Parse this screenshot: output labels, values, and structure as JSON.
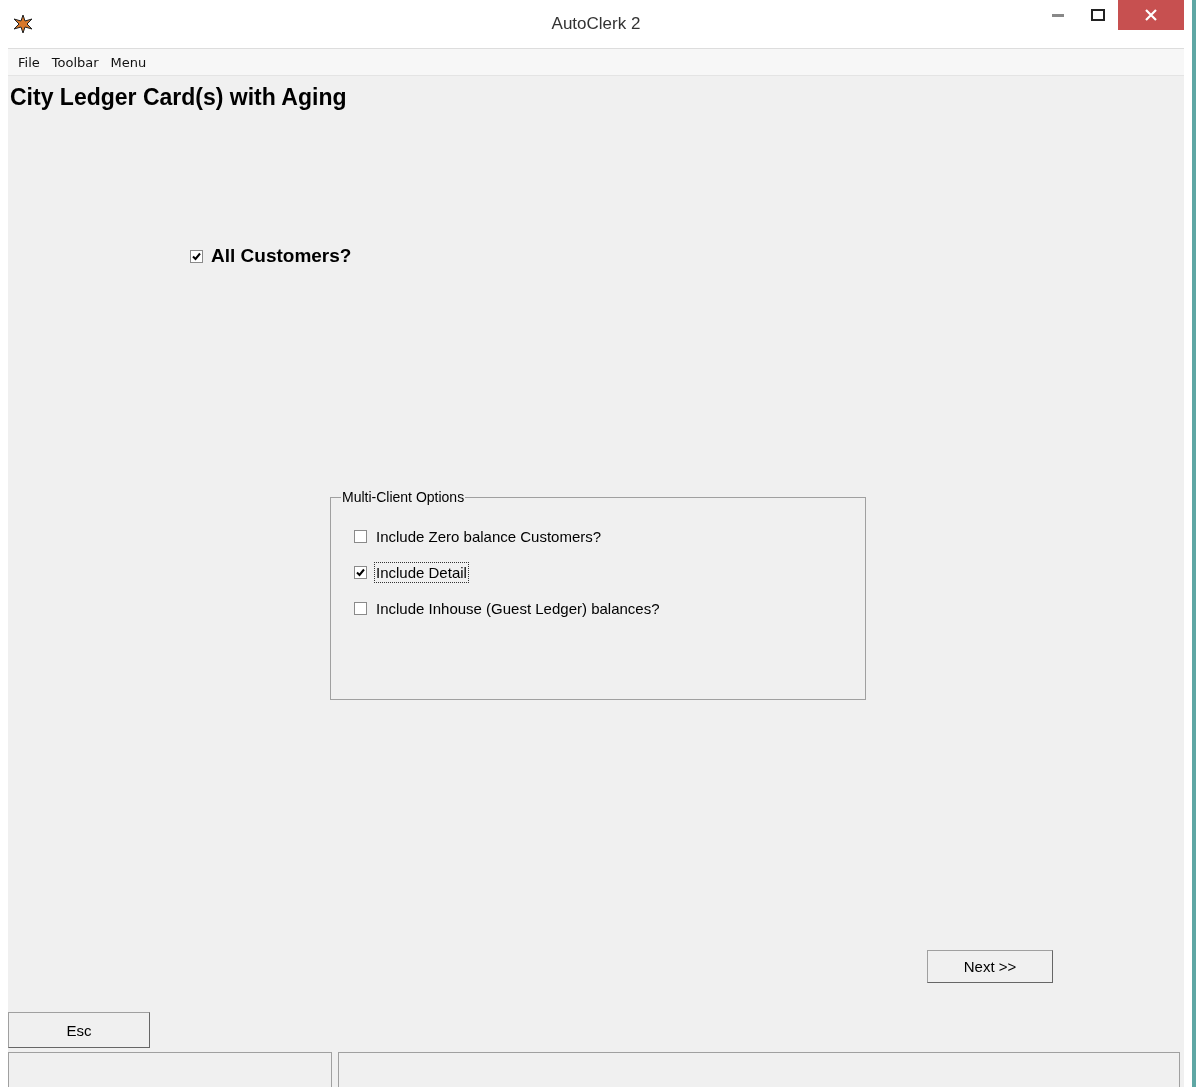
{
  "window": {
    "title": "AutoClerk 2"
  },
  "menu": [
    "File",
    "Toolbar",
    "Menu"
  ],
  "heading": "City Ledger Card(s) with Aging",
  "all_customers": {
    "label": "All Customers?",
    "checked": true
  },
  "group": {
    "title": "Multi-Client Options",
    "options": [
      {
        "label": "Include Zero balance Customers?",
        "checked": false,
        "focused": false
      },
      {
        "label": "Include Detail",
        "checked": true,
        "focused": true
      },
      {
        "label": "Include Inhouse (Guest Ledger) balances?",
        "checked": false,
        "focused": false
      }
    ]
  },
  "buttons": {
    "next": "Next >>",
    "esc": "Esc"
  }
}
